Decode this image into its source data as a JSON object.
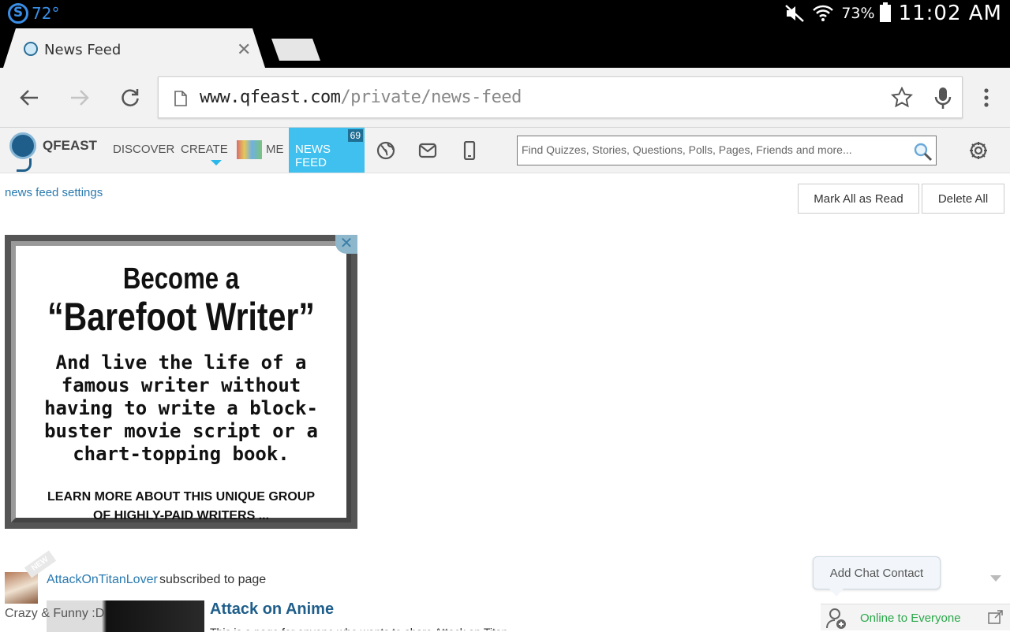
{
  "status_bar": {
    "temperature": "72°",
    "battery_percent": "73%",
    "time": "11:02 AM"
  },
  "browser": {
    "tab_title": "News Feed",
    "url_host": "www.qfeast.com",
    "url_path": "/private/news-feed"
  },
  "site_header": {
    "logo_text": "QFEAST",
    "nav": {
      "discover": "DISCOVER",
      "create": "CREATE",
      "me": "ME",
      "news_feed": "NEWS FEED",
      "news_feed_badge": "69"
    },
    "search_placeholder": "Find Quizzes, Stories, Questions, Polls, Pages, Friends and more...",
    "accent_color": "#3fc0ee"
  },
  "content": {
    "news_feed_settings": "news feed settings",
    "mark_all_read": "Mark All as Read",
    "delete_all": "Delete All"
  },
  "ad": {
    "close_label": "✕",
    "line1": "Become a",
    "line2": "“Barefoot Writer”",
    "body": [
      "And live the life of a",
      "famous writer without",
      "having to write a block-",
      "buster movie script or a",
      "chart-topping book."
    ],
    "cta": [
      "LEARN MORE ABOUT THIS UNIQUE GROUP",
      "OF HIGHLY-PAID WRITERS ..."
    ]
  },
  "feed_item": {
    "ribbon": "NEW",
    "user": "AttackOnTitanLover",
    "action": "subscribed to page",
    "page_caption": "Crazy & Funny :D",
    "title": "Attack on Anime",
    "description_partial": "This is a page for anyone who wants to share Attack on Titan..."
  },
  "chat": {
    "add_contact": "Add Chat Contact",
    "status": "Online to Everyone"
  }
}
